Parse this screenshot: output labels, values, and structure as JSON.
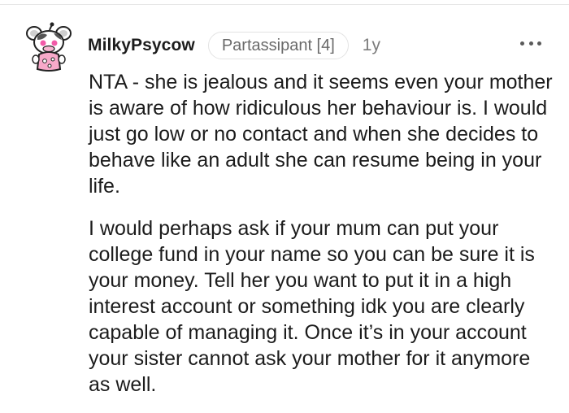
{
  "comment": {
    "username": "MilkyPsycow",
    "flair": "Partassipant [4]",
    "age": "1y",
    "more_icon": "more-horizontal-icon",
    "avatar_icon": "cow-snoo-avatar",
    "paragraphs": [
      "NTA - she is jealous and it seems even your mother is aware of how ridiculous her behaviour is. I would just go low or no contact and when she decides to behave like an adult she can resume being in your life.",
      "I would perhaps ask if your mum can put your college fund in your name so you can be sure it is your money. Tell her you want to put it in a high interest account or something idk you are clearly capable of managing it. Once it’s in your account your sister cannot ask your mother for it anymore as well."
    ]
  },
  "colors": {
    "text": "#1c1c1c",
    "meta": "#7c7c7c",
    "flair_border": "#e3e3e3",
    "avatar_pink": "#f25aa8"
  }
}
